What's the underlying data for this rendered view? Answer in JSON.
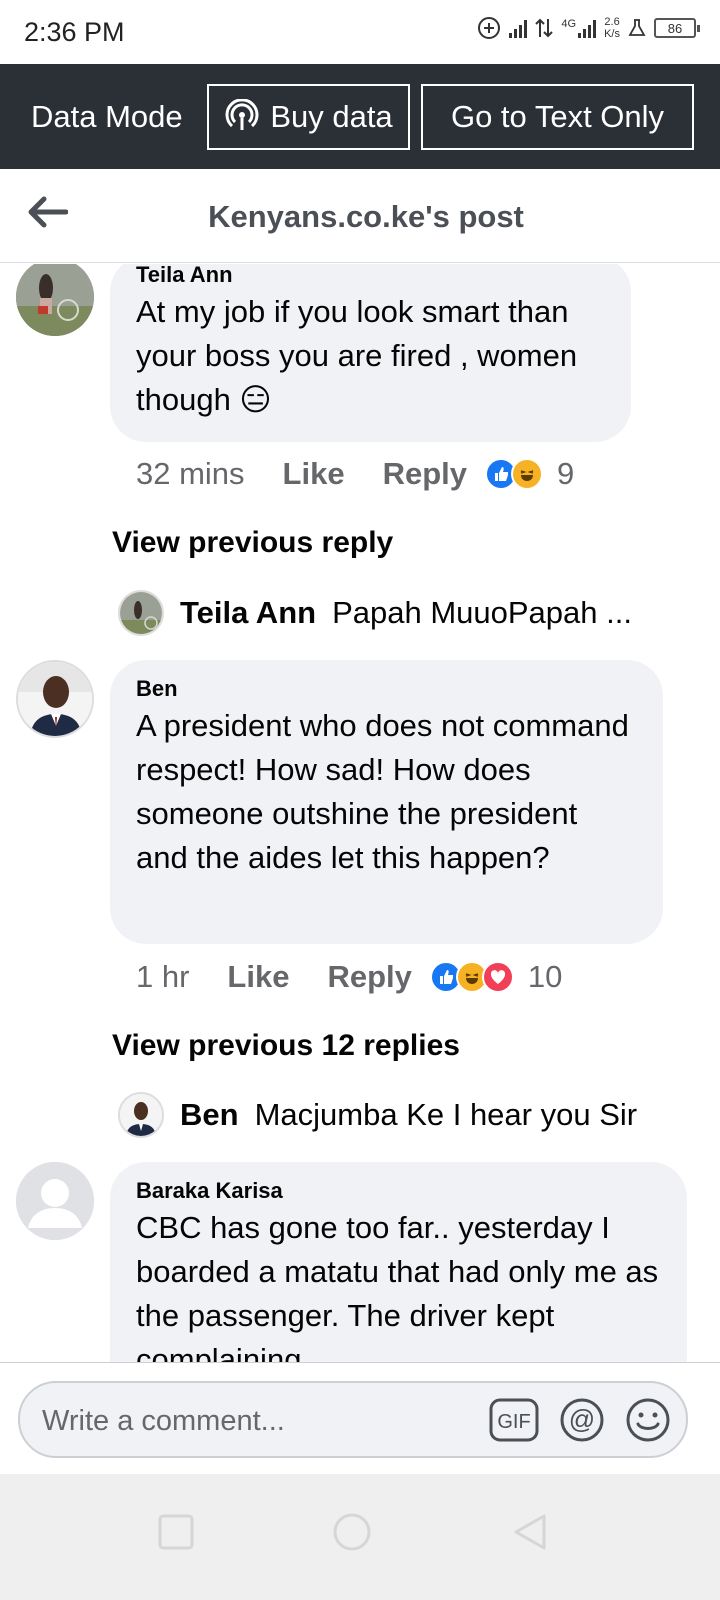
{
  "status_bar": {
    "time": "2:36 PM",
    "net_type": "4G",
    "speed_value": "2.6",
    "speed_unit": "K/s",
    "battery": "86"
  },
  "data_bar": {
    "mode_label": "Data Mode",
    "buy_label": "Buy data",
    "text_only_label": "Go to Text Only"
  },
  "header": {
    "title": "Kenyans.co.ke's post"
  },
  "comments": [
    {
      "author": "Teila Ann",
      "text": "At my job if you look smart than your boss you are fired , women though 😑",
      "time": "32 mins",
      "like_label": "Like",
      "reply_label": "Reply",
      "reaction_count": "9",
      "reactions": [
        "like",
        "haha"
      ],
      "view_previous": "View previous reply",
      "last_reply": {
        "author": "Teila Ann",
        "text": "Papah MuuoPapah ..."
      }
    },
    {
      "author": "Ben",
      "text": "A president who does not command respect! How sad! How does someone outshine the president and the aides let this happen?",
      "time": "1 hr",
      "like_label": "Like",
      "reply_label": "Reply",
      "reaction_count": "10",
      "reactions": [
        "like",
        "haha",
        "love"
      ],
      "view_previous": "View previous 12 replies",
      "last_reply": {
        "author": "Ben",
        "text": "Macjumba Ke I hear you Sir"
      }
    },
    {
      "author": "Baraka Karisa",
      "text": "CBC has gone too far.. yesterday I boarded a matatu that had only me as the passenger. The driver kept complaining"
    }
  ],
  "composer": {
    "placeholder": "Write a comment..."
  },
  "icons": {
    "back": "arrow-left-icon",
    "buy": "broadcast-icon",
    "gif": "gif-icon",
    "mention": "at-sign-icon",
    "emoji": "smiley-icon",
    "nav_recent": "square-icon",
    "nav_home": "circle-icon",
    "nav_back": "triangle-back-icon"
  },
  "colors": {
    "data_bar_bg": "#2b2f36",
    "bubble_bg": "#f0f2f5",
    "secondary_text": "#65676b",
    "like_blue": "#1877f2",
    "haha_yellow": "#f7b125",
    "love_red": "#f33e58"
  }
}
